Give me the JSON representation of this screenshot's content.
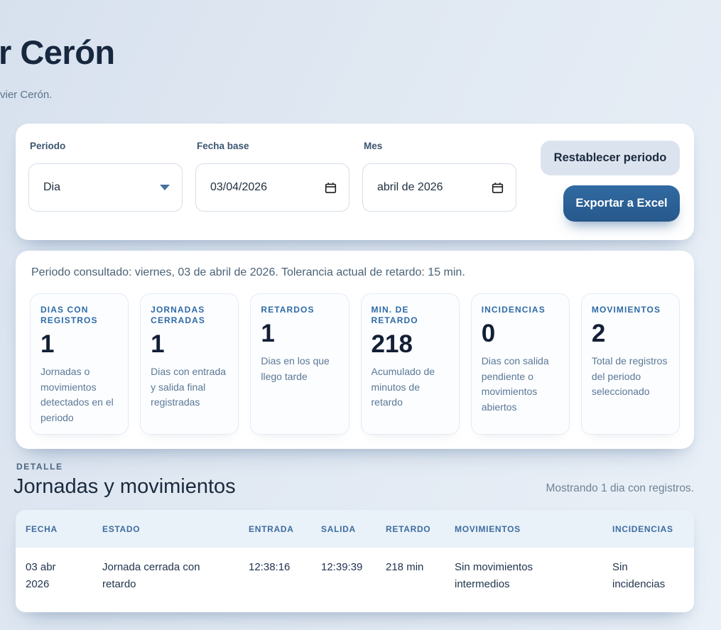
{
  "header": {
    "title_visible": "r Cerón",
    "subtitle_visible": "vier Cerón."
  },
  "filters": {
    "periodo": {
      "label": "Periodo",
      "value": "Dia"
    },
    "fecha_base": {
      "label": "Fecha base",
      "value": "03/04/2026"
    },
    "mes": {
      "label": "Mes",
      "value": "abril de 2026"
    },
    "reset_label": "Restablecer periodo",
    "export_label": "Exportar a Excel"
  },
  "summary": {
    "info": "Periodo consultado: viernes, 03 de abril de 2026. Tolerancia actual de retardo: 15 min.",
    "cards": [
      {
        "label": "DIAS CON\nREGISTROS",
        "value": "1",
        "desc": "Jornadas o\nmovimientos\ndetectados en el\nperiodo"
      },
      {
        "label": "JORNADAS\nCERRADAS",
        "value": "1",
        "desc": "Dias con entrada\ny salida final\nregistradas"
      },
      {
        "label": "RETARDOS",
        "value": "1",
        "desc": "Dias en los que\nllego tarde"
      },
      {
        "label": "MIN. DE\nRETARDO",
        "value": "218",
        "desc": "Acumulado de\nminutos de\nretardo"
      },
      {
        "label": "INCIDENCIAS",
        "value": "0",
        "desc": "Dias con salida\npendiente o\nmovimientos\nabiertos"
      },
      {
        "label": "MOVIMIENTOS",
        "value": "2",
        "desc": "Total de registros\ndel periodo\nseleccionado"
      }
    ]
  },
  "detail": {
    "eyebrow": "DETALLE",
    "heading": "Jornadas y movimientos",
    "showing": "Mostrando 1 dia con registros.",
    "table": {
      "columns": [
        "FECHA",
        "ESTADO",
        "ENTRADA",
        "SALIDA",
        "RETARDO",
        "MOVIMIENTOS",
        "INCIDENCIAS"
      ],
      "rows": [
        [
          "03 abr\n2026",
          "Jornada cerrada con\nretardo",
          "12:38:16",
          "12:39:39",
          "218 min",
          "Sin movimientos\nintermedios",
          "Sin\nincidencias"
        ]
      ]
    }
  },
  "icons": {
    "periodo_caret": "chevron-down-icon",
    "fecha_base_icon": "calendar-icon",
    "mes_icon": "calendar-icon"
  },
  "colors": {
    "accent_blue": "#2e6ba6",
    "export_button": "#2b619a",
    "reset_button": "#dbe3ee",
    "number_navy": "#121f36",
    "table_header_bg": "#e9f1f9",
    "table_header_text": "#3e6d9e",
    "page_background": "#e0e8f2",
    "card_background": "#ffffff"
  }
}
